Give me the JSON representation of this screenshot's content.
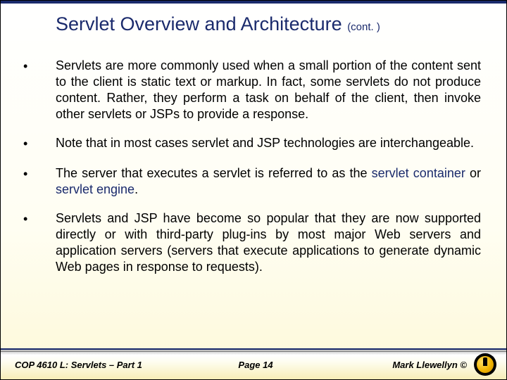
{
  "title": {
    "main": "Servlet Overview and Architecture ",
    "cont": "(cont. )"
  },
  "bullets": [
    {
      "text": "Servlets are more commonly used when a small portion of the content sent to the client is static text or markup.  In fact, some servlets do not produce content. Rather, they perform a task on behalf of the client, then invoke other servlets or JSPs to provide a response."
    },
    {
      "text": "Note that in most cases servlet and JSP technologies are interchangeable."
    },
    {
      "pre": "The server that executes a servlet is referred to as the ",
      "term1": "servlet container",
      "mid": " or ",
      "term2": "servlet engine",
      "post": "."
    },
    {
      "text": "Servlets and JSP have become so popular that they are now supported directly or with third-party plug-ins by most major Web servers and application servers (servers that execute applications to generate dynamic Web pages in response to requests)."
    }
  ],
  "footer": {
    "left": "COP 4610 L: Servlets – Part 1",
    "center": "Page 14",
    "right": "Mark Llewellyn ©"
  }
}
